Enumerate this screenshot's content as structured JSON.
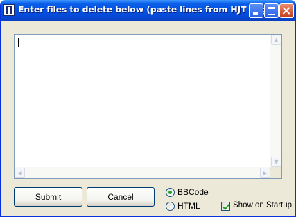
{
  "window": {
    "title": "Enter files to delete below (paste lines from HJT Log)"
  },
  "editor": {
    "content": ""
  },
  "buttons": {
    "submit_label": "Submit",
    "cancel_label": "Cancel"
  },
  "format_options": {
    "selected": "BBCode",
    "items": [
      {
        "label": "BBCode",
        "selected": true
      },
      {
        "label": "HTML",
        "selected": false
      }
    ]
  },
  "show_on_startup": {
    "label": "Show on Startup",
    "checked": true
  },
  "icons": {
    "app": "hjt-app-icon",
    "minimize": "minimize-icon",
    "maximize": "maximize-icon",
    "close": "close-icon"
  },
  "colors": {
    "titlebar": "#0553e3",
    "window_bg": "#ece9d8",
    "close_button": "#c23c17",
    "check_mark": "#21a121"
  }
}
